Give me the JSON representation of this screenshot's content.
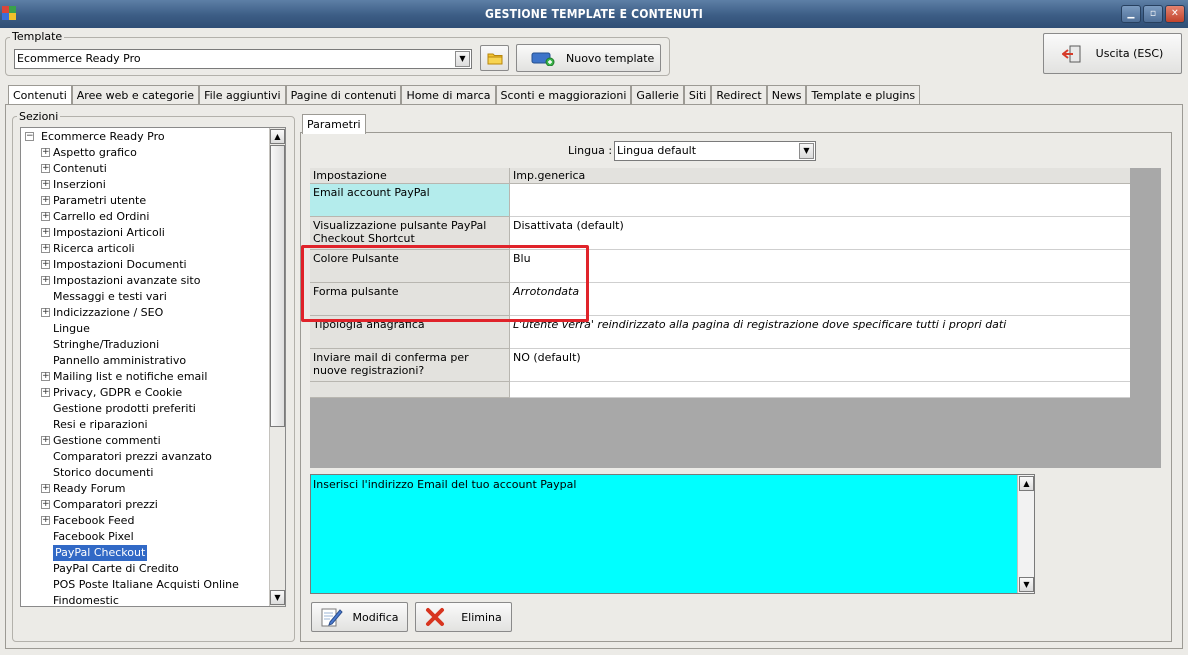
{
  "window": {
    "title": "GESTIONE TEMPLATE E CONTENUTI"
  },
  "template_group": {
    "label": "Template",
    "selected": "Ecommerce Ready Pro",
    "new_button": "Nuovo template"
  },
  "exit_button": "Uscita (ESC)",
  "tabs": [
    {
      "label": "Contenuti"
    },
    {
      "label": "Aree web e categorie"
    },
    {
      "label": "File aggiuntivi"
    },
    {
      "label": "Pagine di contenuti"
    },
    {
      "label": "Home di marca"
    },
    {
      "label": "Sconti e maggiorazioni"
    },
    {
      "label": "Gallerie"
    },
    {
      "label": "Siti"
    },
    {
      "label": "Redirect"
    },
    {
      "label": "News"
    },
    {
      "label": "Template e plugins"
    }
  ],
  "sections": {
    "label": "Sezioni",
    "root": "Ecommerce Ready Pro",
    "items": [
      {
        "label": "Aspetto grafico",
        "expandable": true
      },
      {
        "label": "Contenuti",
        "expandable": true
      },
      {
        "label": "Inserzioni",
        "expandable": true
      },
      {
        "label": "Parametri utente",
        "expandable": true
      },
      {
        "label": "Carrello ed Ordini",
        "expandable": true
      },
      {
        "label": "Impostazioni Articoli",
        "expandable": true
      },
      {
        "label": "Ricerca articoli",
        "expandable": true
      },
      {
        "label": "Impostazioni Documenti",
        "expandable": true
      },
      {
        "label": "Impostazioni avanzate sito",
        "expandable": true
      },
      {
        "label": "Messaggi e testi vari",
        "expandable": false
      },
      {
        "label": "Indicizzazione / SEO",
        "expandable": true
      },
      {
        "label": "Lingue",
        "expandable": false
      },
      {
        "label": "Stringhe/Traduzioni",
        "expandable": false
      },
      {
        "label": "Pannello amministrativo",
        "expandable": false
      },
      {
        "label": "Mailing list e notifiche email",
        "expandable": true
      },
      {
        "label": "Privacy, GDPR e Cookie",
        "expandable": true
      },
      {
        "label": "Gestione prodotti preferiti",
        "expandable": false
      },
      {
        "label": "Resi e riparazioni",
        "expandable": false
      },
      {
        "label": "Gestione commenti",
        "expandable": true
      },
      {
        "label": "Comparatori prezzi avanzato",
        "expandable": false
      },
      {
        "label": "Storico documenti",
        "expandable": false
      },
      {
        "label": "Ready Forum",
        "expandable": true
      },
      {
        "label": "Comparatori prezzi",
        "expandable": true
      },
      {
        "label": "Facebook Feed",
        "expandable": true
      },
      {
        "label": "Facebook Pixel",
        "expandable": false
      },
      {
        "label": "PayPal Checkout",
        "expandable": false,
        "selected": true
      },
      {
        "label": "PayPal Carte di Credito",
        "expandable": false
      },
      {
        "label": "POS Poste Italiane Acquisti Online",
        "expandable": false
      },
      {
        "label": "Findomestic",
        "expandable": false
      }
    ]
  },
  "params": {
    "tab_label": "Parametri",
    "language_label": "Lingua :",
    "language_value": "Lingua default",
    "columns": [
      "Impostazione",
      "Imp.generica"
    ],
    "rows": [
      {
        "setting": "Email account PayPal",
        "value": "",
        "italic": false
      },
      {
        "setting": "Visualizzazione pulsante PayPal Checkout Shortcut",
        "value": "Disattivata (default)",
        "italic": false
      },
      {
        "setting": "Colore Pulsante",
        "value": "Blu",
        "italic": false
      },
      {
        "setting": "Forma pulsante",
        "value": "Arrotondata",
        "italic": true
      },
      {
        "setting": "Tipologia anagrafica",
        "value": "L'utente verra' reindirizzato alla pagina di registrazione dove specificare tutti i propri dati",
        "italic": true
      },
      {
        "setting": "Inviare mail di conferma per nuove registrazioni?",
        "value": "NO (default)",
        "italic": false
      },
      {
        "setting": "",
        "value": "",
        "italic": false
      }
    ],
    "description": "Inserisci l'indirizzo Email del tuo account Paypal",
    "modify_button": "Modifica",
    "delete_button": "Elimina"
  },
  "colors": {
    "titlebar": "#3c5d85",
    "selection": "#3169c6",
    "description_bg": "#00ffff",
    "highlight_border": "#e0232a"
  }
}
